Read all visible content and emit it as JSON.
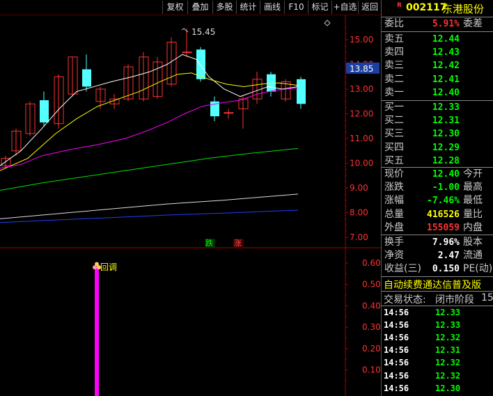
{
  "toolbar": {
    "buttons": [
      "复权",
      "叠加",
      "多股",
      "统计",
      "画线",
      "F10",
      "标记",
      "+自选",
      "返回"
    ]
  },
  "header": {
    "r_badge": "R",
    "code": "002117",
    "name": "东港股份"
  },
  "chart": {
    "high_label": "15.45",
    "price_marker": "13.85",
    "yaxis_ticks": [
      "15.00",
      "14.00",
      "13.00",
      "12.00",
      "11.00",
      "10.00",
      "9.00",
      "8.00",
      "7.00"
    ],
    "lower_ticks": [
      "0.60",
      "0.50",
      "0.40",
      "0.30",
      "0.20",
      "0.10"
    ],
    "signal_die": "跌",
    "signal_zhang": "涨",
    "annotation": "回调",
    "colors": {
      "up": "#ff3232",
      "down": "#54ffff",
      "ma5": "#ffffff",
      "ma10": "#ffff00",
      "ma20": "#ff00ff",
      "ma60": "#00e600",
      "ma120": "#dddddd",
      "ma250": "#2040ff",
      "indicator": "#ff00ff"
    }
  },
  "quote": {
    "webi_label": "委比",
    "webi_value": "5.91%",
    "weicha_label": "委差",
    "sells": [
      {
        "label": "卖五",
        "price": "12.44"
      },
      {
        "label": "卖四",
        "price": "12.43"
      },
      {
        "label": "卖三",
        "price": "12.42"
      },
      {
        "label": "卖二",
        "price": "12.41"
      },
      {
        "label": "卖一",
        "price": "12.40"
      }
    ],
    "buys": [
      {
        "label": "买一",
        "price": "12.33"
      },
      {
        "label": "买二",
        "price": "12.31"
      },
      {
        "label": "买三",
        "price": "12.30"
      },
      {
        "label": "买四",
        "price": "12.29"
      },
      {
        "label": "买五",
        "price": "12.28"
      }
    ],
    "stats": [
      {
        "label": "现价",
        "value": "12.40",
        "label2": "今开",
        "color": "#00ff00"
      },
      {
        "label": "涨跌",
        "value": "-1.00",
        "label2": "最高",
        "color": "#00ff00"
      },
      {
        "label": "涨幅",
        "value": "-7.46%",
        "label2": "最低",
        "color": "#00ff00"
      },
      {
        "label": "总量",
        "value": "416526",
        "label2": "量比",
        "color": "#ffff00"
      },
      {
        "label": "外盘",
        "value": "155059",
        "label2": "内盘",
        "color": "#ff3232"
      }
    ],
    "stats2": [
      {
        "label": "换手",
        "value": "7.96%",
        "label2": "股本",
        "color": "#ffffff"
      },
      {
        "label": "净资",
        "value": "2.47",
        "label2": "流通",
        "color": "#ffffff"
      },
      {
        "label": "收益(三)",
        "value": "0.150",
        "label2": "PE(动)",
        "color": "#ffffff"
      }
    ],
    "banner": "自动续费通达信普及版",
    "status_label": "交易状态:",
    "status_value": "闭市阶段",
    "status_extra": "15",
    "ticks": [
      {
        "time": "14:56",
        "price": "12.33"
      },
      {
        "time": "14:56",
        "price": "12.33"
      },
      {
        "time": "14:56",
        "price": "12.32"
      },
      {
        "time": "14:56",
        "price": "12.31"
      },
      {
        "time": "14:56",
        "price": "12.32"
      },
      {
        "time": "14:56",
        "price": "12.32"
      },
      {
        "time": "14:56",
        "price": "12.30"
      }
    ]
  }
}
